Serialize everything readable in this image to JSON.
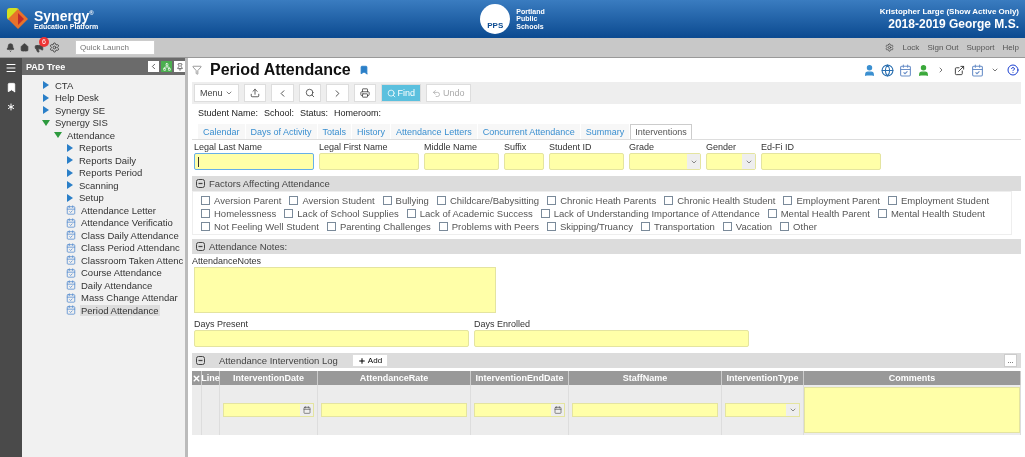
{
  "header": {
    "brand": "Synergy",
    "brand_mark": "®",
    "brand_sub": "Education Platform",
    "district_logo": "PPS",
    "district_name": [
      "Portland",
      "Public",
      "Schools"
    ],
    "user": "Kristopher Large (Show Active Only)",
    "school_year": "2018-2019 George M.S."
  },
  "topbar": {
    "notification_count": "6",
    "quick_launch": {
      "placeholder": "Quick Launch"
    },
    "links": [
      "Lock",
      "Sign Out",
      "Support",
      "Help"
    ]
  },
  "tree": {
    "title": "PAD Tree",
    "items": [
      {
        "label": "CTA",
        "kind": "folder",
        "expanded": false,
        "selected": false
      },
      {
        "label": "Help Desk",
        "kind": "folder",
        "expanded": false,
        "selected": false
      },
      {
        "label": "Synergy SE",
        "kind": "folder",
        "expanded": false,
        "selected": false
      },
      {
        "label": "Synergy SIS",
        "kind": "folder",
        "expanded": true,
        "selected": false,
        "children": [
          {
            "label": "Attendance",
            "kind": "folder",
            "expanded": true,
            "selected": false,
            "children": [
              {
                "label": "Reports",
                "kind": "folder",
                "expanded": false,
                "selected": false
              },
              {
                "label": "Reports Daily",
                "kind": "folder",
                "expanded": false,
                "selected": false
              },
              {
                "label": "Reports Period",
                "kind": "folder",
                "expanded": false,
                "selected": false
              },
              {
                "label": "Scanning",
                "kind": "folder",
                "expanded": false,
                "selected": false
              },
              {
                "label": "Setup",
                "kind": "folder",
                "expanded": false,
                "selected": false
              },
              {
                "label": "Attendance Letter",
                "kind": "page",
                "selected": false
              },
              {
                "label": "Attendance Verificatio",
                "kind": "page",
                "selected": false
              },
              {
                "label": "Class Daily Attendance",
                "kind": "page",
                "selected": false
              },
              {
                "label": "Class Period Attendanc",
                "kind": "page",
                "selected": false
              },
              {
                "label": "Classroom Taken Attenc",
                "kind": "page",
                "selected": false
              },
              {
                "label": "Course Attendance",
                "kind": "page",
                "selected": false
              },
              {
                "label": "Daily Attendance",
                "kind": "page",
                "selected": false
              },
              {
                "label": "Mass Change Attendar",
                "kind": "page",
                "selected": false
              },
              {
                "label": "Period Attendance",
                "kind": "page",
                "selected": true
              }
            ]
          }
        ]
      }
    ]
  },
  "page": {
    "title": "Period Attendance",
    "toolbar": [
      {
        "kind": "menu",
        "label": "Menu"
      },
      {
        "kind": "export"
      },
      {
        "kind": "prev"
      },
      {
        "kind": "search"
      },
      {
        "kind": "next"
      },
      {
        "kind": "print"
      },
      {
        "kind": "find",
        "label": "Find",
        "disabled": false
      },
      {
        "kind": "undo",
        "label": "Undo",
        "disabled": true
      }
    ],
    "student_info": [
      "Student Name:",
      "School:",
      "Status:",
      "Homeroom:"
    ],
    "tabs": [
      {
        "label": "Calendar",
        "selected": false
      },
      {
        "label": "Days of Activity",
        "selected": false
      },
      {
        "label": "Totals",
        "selected": false
      },
      {
        "label": "History",
        "selected": false
      },
      {
        "label": "Attendance Letters",
        "selected": false
      },
      {
        "label": "Concurrent Attendance",
        "selected": false
      },
      {
        "label": "Summary",
        "selected": false
      },
      {
        "label": "Interventions",
        "selected": true
      }
    ],
    "fields": [
      {
        "label": "Legal Last Name",
        "kind": "text",
        "focused": true
      },
      {
        "label": "Legal First Name",
        "kind": "text",
        "focused": false
      },
      {
        "label": "Middle Name",
        "kind": "text",
        "focused": false
      },
      {
        "label": "Suffix",
        "kind": "text",
        "focused": false
      },
      {
        "label": "Student ID",
        "kind": "text",
        "focused": false
      },
      {
        "label": "Grade",
        "kind": "select",
        "focused": false
      },
      {
        "label": "Gender",
        "kind": "select",
        "focused": false
      },
      {
        "label": "Ed-Fi ID",
        "kind": "text",
        "focused": false
      }
    ],
    "factors": {
      "title": "Factors Affecting Attendance",
      "expanded": true,
      "options": [
        {
          "label": "Aversion Parent",
          "checked": false
        },
        {
          "label": "Aversion Student",
          "checked": false
        },
        {
          "label": "Bullying",
          "checked": false
        },
        {
          "label": "Childcare/Babysitting",
          "checked": false
        },
        {
          "label": "Chronic Heath Parents",
          "checked": false
        },
        {
          "label": "Chronic Health Student",
          "checked": false
        },
        {
          "label": "Employment Parent",
          "checked": false
        },
        {
          "label": "Employment Student",
          "checked": false
        },
        {
          "label": "Homelessness",
          "checked": false
        },
        {
          "label": "Lack of School Supplies",
          "checked": false
        },
        {
          "label": "Lack of Academic Success",
          "checked": false
        },
        {
          "label": "Lack of Understanding Importance of Attendance",
          "checked": false
        },
        {
          "label": "Mental Health Parent",
          "checked": false
        },
        {
          "label": "Mental Health Student",
          "checked": false
        },
        {
          "label": "Not Feeling Well Student",
          "checked": false
        },
        {
          "label": "Parenting Challenges",
          "checked": false
        },
        {
          "label": "Problems with Peers",
          "checked": false
        },
        {
          "label": "Skipping/Truancy",
          "checked": false
        },
        {
          "label": "Transportation",
          "checked": false
        },
        {
          "label": "Vacation",
          "checked": false
        },
        {
          "label": "Other",
          "checked": false
        }
      ]
    },
    "notes": {
      "title": "Attendance Notes:",
      "expanded": true,
      "label": "AttendanceNotes"
    },
    "days": [
      {
        "label": "Days Present"
      },
      {
        "label": "Days Enrolled"
      }
    ],
    "log": {
      "title": "Attendance Intervention Log",
      "expanded": true,
      "add": "Add",
      "more": "...",
      "columns": [
        {
          "label": "Line",
          "kind": "none"
        },
        {
          "label": "InterventionDate",
          "kind": "date"
        },
        {
          "label": "AttendanceRate",
          "kind": "text"
        },
        {
          "label": "InterventionEndDate",
          "kind": "date"
        },
        {
          "label": "StaffName",
          "kind": "text"
        },
        {
          "label": "InterventionType",
          "kind": "select"
        },
        {
          "label": "Comments",
          "kind": "area"
        }
      ]
    }
  }
}
